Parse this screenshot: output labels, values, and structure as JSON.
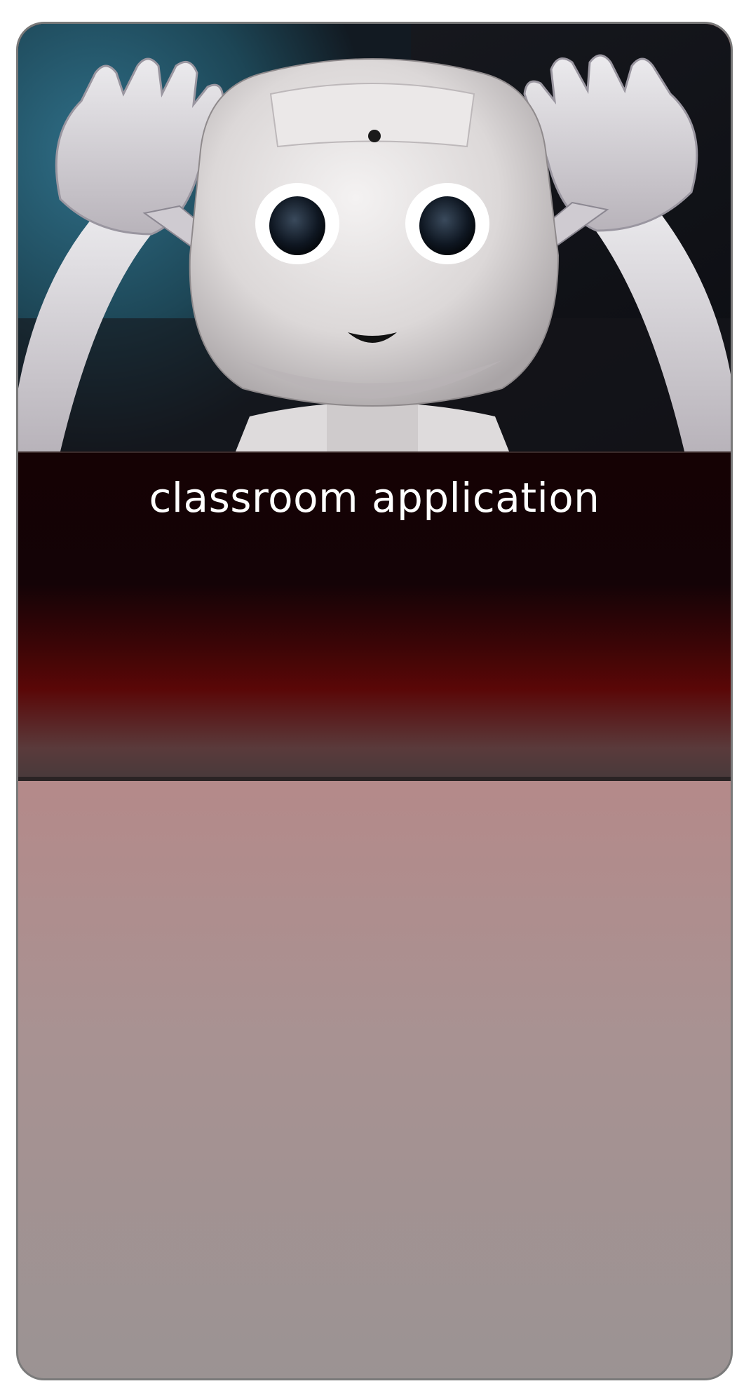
{
  "card": {
    "title": "classroom application",
    "image_icon": "robot-photo"
  },
  "colors": {
    "banner_dark": "#150204",
    "banner_red": "#5a0707",
    "lower_top": "#e06a68",
    "lower_bottom": "#9b9393",
    "title_text": "#ffffff"
  }
}
